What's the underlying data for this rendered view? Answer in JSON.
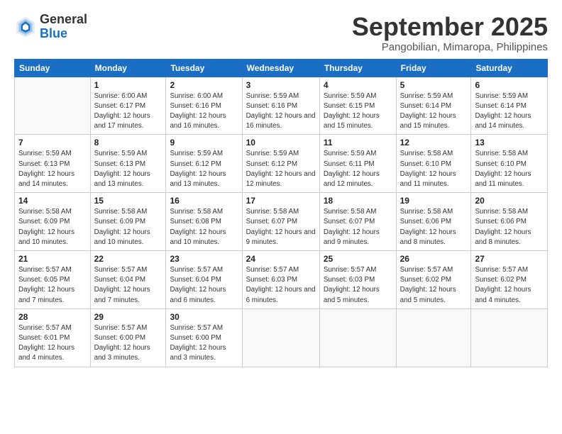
{
  "logo": {
    "general": "General",
    "blue": "Blue"
  },
  "title": "September 2025",
  "location": "Pangobilian, Mimaropa, Philippines",
  "days_of_week": [
    "Sunday",
    "Monday",
    "Tuesday",
    "Wednesday",
    "Thursday",
    "Friday",
    "Saturday"
  ],
  "weeks": [
    [
      {
        "day": "",
        "sunrise": "",
        "sunset": "",
        "daylight": ""
      },
      {
        "day": "1",
        "sunrise": "Sunrise: 6:00 AM",
        "sunset": "Sunset: 6:17 PM",
        "daylight": "Daylight: 12 hours and 17 minutes."
      },
      {
        "day": "2",
        "sunrise": "Sunrise: 6:00 AM",
        "sunset": "Sunset: 6:16 PM",
        "daylight": "Daylight: 12 hours and 16 minutes."
      },
      {
        "day": "3",
        "sunrise": "Sunrise: 5:59 AM",
        "sunset": "Sunset: 6:16 PM",
        "daylight": "Daylight: 12 hours and 16 minutes."
      },
      {
        "day": "4",
        "sunrise": "Sunrise: 5:59 AM",
        "sunset": "Sunset: 6:15 PM",
        "daylight": "Daylight: 12 hours and 15 minutes."
      },
      {
        "day": "5",
        "sunrise": "Sunrise: 5:59 AM",
        "sunset": "Sunset: 6:14 PM",
        "daylight": "Daylight: 12 hours and 15 minutes."
      },
      {
        "day": "6",
        "sunrise": "Sunrise: 5:59 AM",
        "sunset": "Sunset: 6:14 PM",
        "daylight": "Daylight: 12 hours and 14 minutes."
      }
    ],
    [
      {
        "day": "7",
        "sunrise": "Sunrise: 5:59 AM",
        "sunset": "Sunset: 6:13 PM",
        "daylight": "Daylight: 12 hours and 14 minutes."
      },
      {
        "day": "8",
        "sunrise": "Sunrise: 5:59 AM",
        "sunset": "Sunset: 6:13 PM",
        "daylight": "Daylight: 12 hours and 13 minutes."
      },
      {
        "day": "9",
        "sunrise": "Sunrise: 5:59 AM",
        "sunset": "Sunset: 6:12 PM",
        "daylight": "Daylight: 12 hours and 13 minutes."
      },
      {
        "day": "10",
        "sunrise": "Sunrise: 5:59 AM",
        "sunset": "Sunset: 6:12 PM",
        "daylight": "Daylight: 12 hours and 12 minutes."
      },
      {
        "day": "11",
        "sunrise": "Sunrise: 5:59 AM",
        "sunset": "Sunset: 6:11 PM",
        "daylight": "Daylight: 12 hours and 12 minutes."
      },
      {
        "day": "12",
        "sunrise": "Sunrise: 5:58 AM",
        "sunset": "Sunset: 6:10 PM",
        "daylight": "Daylight: 12 hours and 11 minutes."
      },
      {
        "day": "13",
        "sunrise": "Sunrise: 5:58 AM",
        "sunset": "Sunset: 6:10 PM",
        "daylight": "Daylight: 12 hours and 11 minutes."
      }
    ],
    [
      {
        "day": "14",
        "sunrise": "Sunrise: 5:58 AM",
        "sunset": "Sunset: 6:09 PM",
        "daylight": "Daylight: 12 hours and 10 minutes."
      },
      {
        "day": "15",
        "sunrise": "Sunrise: 5:58 AM",
        "sunset": "Sunset: 6:09 PM",
        "daylight": "Daylight: 12 hours and 10 minutes."
      },
      {
        "day": "16",
        "sunrise": "Sunrise: 5:58 AM",
        "sunset": "Sunset: 6:08 PM",
        "daylight": "Daylight: 12 hours and 10 minutes."
      },
      {
        "day": "17",
        "sunrise": "Sunrise: 5:58 AM",
        "sunset": "Sunset: 6:07 PM",
        "daylight": "Daylight: 12 hours and 9 minutes."
      },
      {
        "day": "18",
        "sunrise": "Sunrise: 5:58 AM",
        "sunset": "Sunset: 6:07 PM",
        "daylight": "Daylight: 12 hours and 9 minutes."
      },
      {
        "day": "19",
        "sunrise": "Sunrise: 5:58 AM",
        "sunset": "Sunset: 6:06 PM",
        "daylight": "Daylight: 12 hours and 8 minutes."
      },
      {
        "day": "20",
        "sunrise": "Sunrise: 5:58 AM",
        "sunset": "Sunset: 6:06 PM",
        "daylight": "Daylight: 12 hours and 8 minutes."
      }
    ],
    [
      {
        "day": "21",
        "sunrise": "Sunrise: 5:57 AM",
        "sunset": "Sunset: 6:05 PM",
        "daylight": "Daylight: 12 hours and 7 minutes."
      },
      {
        "day": "22",
        "sunrise": "Sunrise: 5:57 AM",
        "sunset": "Sunset: 6:04 PM",
        "daylight": "Daylight: 12 hours and 7 minutes."
      },
      {
        "day": "23",
        "sunrise": "Sunrise: 5:57 AM",
        "sunset": "Sunset: 6:04 PM",
        "daylight": "Daylight: 12 hours and 6 minutes."
      },
      {
        "day": "24",
        "sunrise": "Sunrise: 5:57 AM",
        "sunset": "Sunset: 6:03 PM",
        "daylight": "Daylight: 12 hours and 6 minutes."
      },
      {
        "day": "25",
        "sunrise": "Sunrise: 5:57 AM",
        "sunset": "Sunset: 6:03 PM",
        "daylight": "Daylight: 12 hours and 5 minutes."
      },
      {
        "day": "26",
        "sunrise": "Sunrise: 5:57 AM",
        "sunset": "Sunset: 6:02 PM",
        "daylight": "Daylight: 12 hours and 5 minutes."
      },
      {
        "day": "27",
        "sunrise": "Sunrise: 5:57 AM",
        "sunset": "Sunset: 6:02 PM",
        "daylight": "Daylight: 12 hours and 4 minutes."
      }
    ],
    [
      {
        "day": "28",
        "sunrise": "Sunrise: 5:57 AM",
        "sunset": "Sunset: 6:01 PM",
        "daylight": "Daylight: 12 hours and 4 minutes."
      },
      {
        "day": "29",
        "sunrise": "Sunrise: 5:57 AM",
        "sunset": "Sunset: 6:00 PM",
        "daylight": "Daylight: 12 hours and 3 minutes."
      },
      {
        "day": "30",
        "sunrise": "Sunrise: 5:57 AM",
        "sunset": "Sunset: 6:00 PM",
        "daylight": "Daylight: 12 hours and 3 minutes."
      },
      {
        "day": "",
        "sunrise": "",
        "sunset": "",
        "daylight": ""
      },
      {
        "day": "",
        "sunrise": "",
        "sunset": "",
        "daylight": ""
      },
      {
        "day": "",
        "sunrise": "",
        "sunset": "",
        "daylight": ""
      },
      {
        "day": "",
        "sunrise": "",
        "sunset": "",
        "daylight": ""
      }
    ]
  ]
}
